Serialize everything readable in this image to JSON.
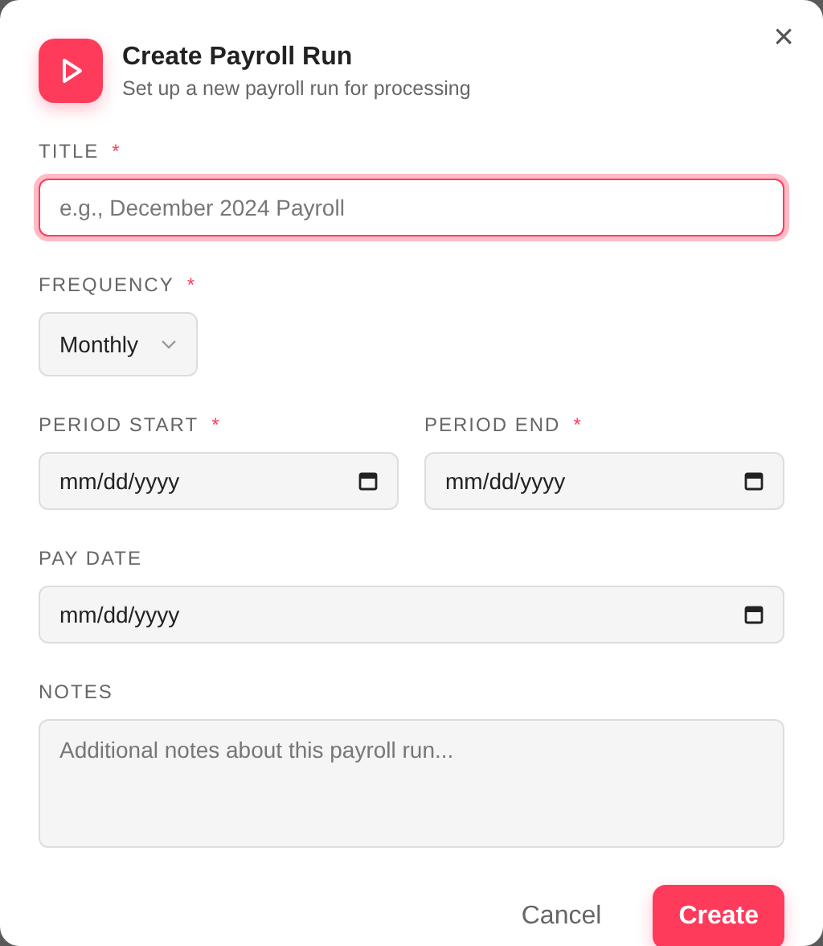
{
  "dialog": {
    "title": "Create Payroll Run",
    "subtitle": "Set up a new payroll run for processing",
    "close": "×"
  },
  "rows": [
    {
      "fields": [
        {
          "kind": "text",
          "label": "TITLE",
          "required_mark": "*",
          "placeholder": "e.g., December 2024 Payroll",
          "focused": true
        }
      ]
    },
    {
      "fields": [
        {
          "kind": "select",
          "label": "FREQUENCY",
          "required_mark": "*",
          "value": "Monthly",
          "focused": false
        }
      ]
    },
    {
      "fields": [
        {
          "kind": "date",
          "label": "PERIOD START",
          "required_mark": "*",
          "placeholder": "mm/dd/yyyy",
          "focused": false
        },
        {
          "kind": "date",
          "label": "PERIOD END",
          "required_mark": "*",
          "placeholder": "mm/dd/yyyy",
          "focused": false
        }
      ]
    },
    {
      "fields": [
        {
          "kind": "date",
          "label": "PAY DATE",
          "placeholder": "mm/dd/yyyy",
          "focused": false
        }
      ]
    },
    {
      "fields": [
        {
          "kind": "textarea",
          "label": "NOTES",
          "placeholder": "Additional notes about this payroll run...",
          "focused": false
        }
      ]
    }
  ],
  "buttons": [
    {
      "label": "Cancel",
      "kind": "secondary"
    },
    {
      "label": "Create",
      "kind": "primary"
    }
  ]
}
